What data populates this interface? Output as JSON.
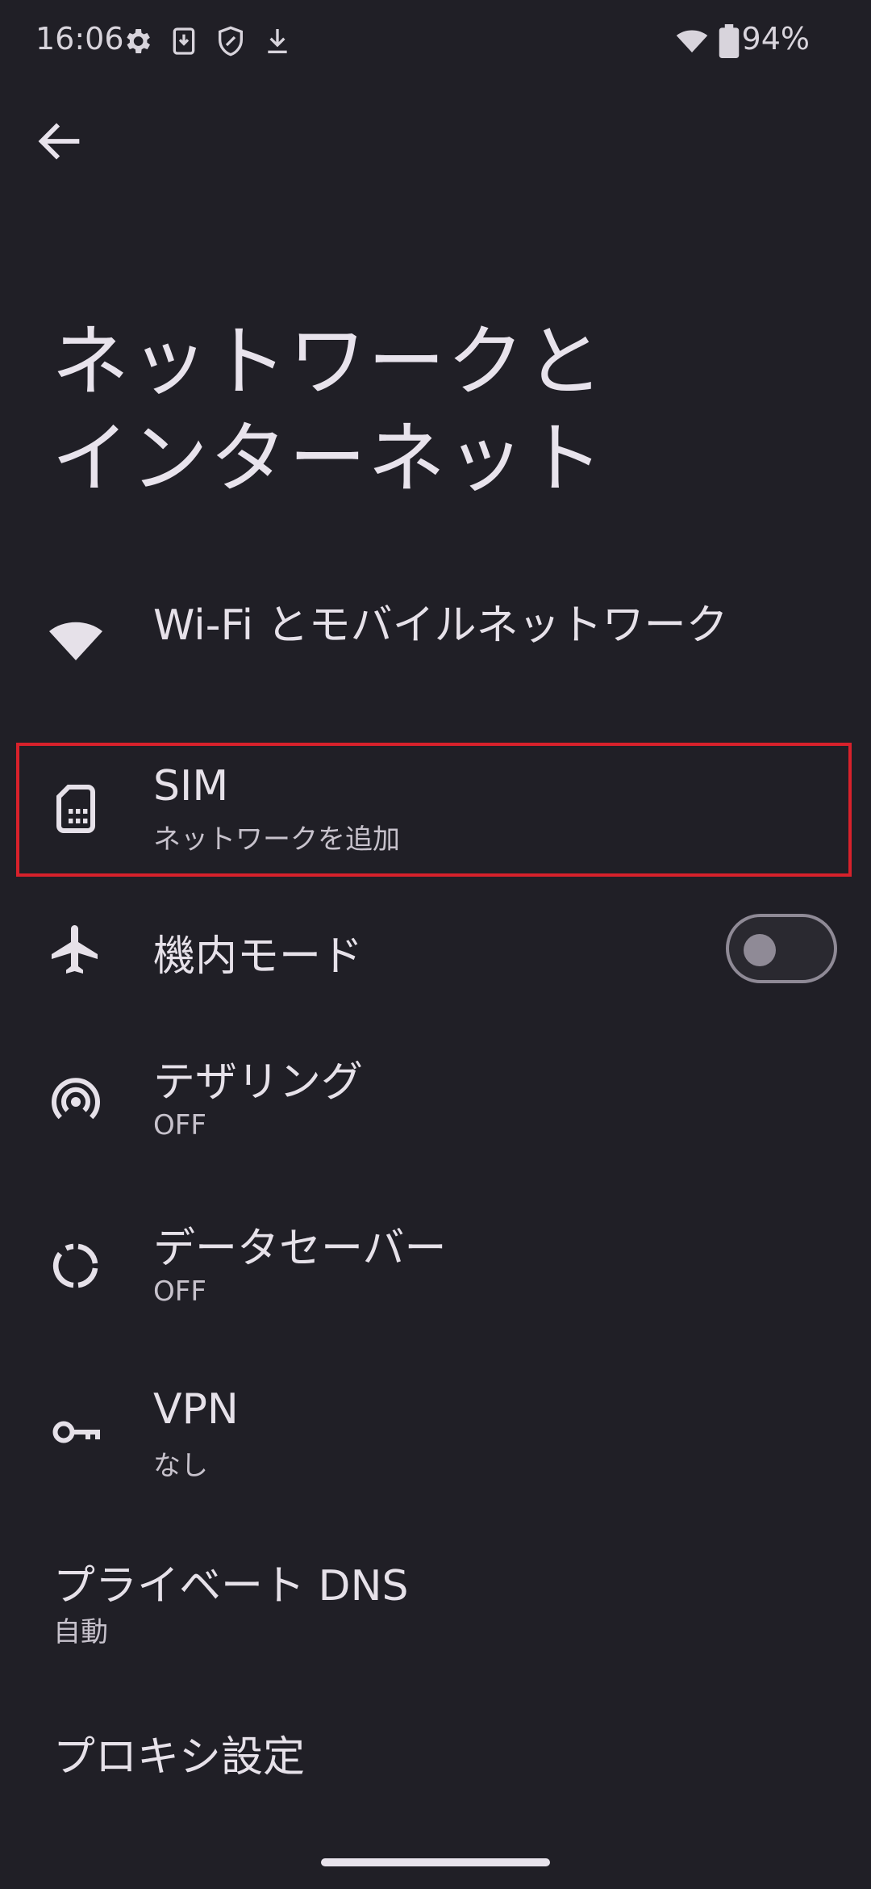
{
  "status_bar": {
    "time": "16:06",
    "icons": [
      "gear-icon",
      "download-box-icon",
      "shield-icon",
      "download-icon"
    ],
    "right_icons": [
      "wifi-icon",
      "battery-icon"
    ],
    "battery": "94%"
  },
  "header": {
    "back_icon": "back-arrow-icon",
    "title_line1": "ネットワークと",
    "title_line2": "インターネット"
  },
  "items": [
    {
      "icon": "wifi-icon",
      "title": "Wi-Fi とモバイルネットワーク"
    },
    {
      "icon": "sim-icon",
      "title": "SIM",
      "subtitle": "ネットワークを追加"
    },
    {
      "icon": "airplane-icon",
      "title": "機内モード",
      "toggle_on": false
    },
    {
      "icon": "hotspot-icon",
      "title": "テザリング",
      "subtitle": "OFF"
    },
    {
      "icon": "data-saver-icon",
      "title": "データセーバー",
      "subtitle": "OFF"
    },
    {
      "icon": "vpn-key-icon",
      "title": "VPN",
      "subtitle": "なし"
    },
    {
      "title": "プライベート DNS",
      "subtitle": "自動"
    },
    {
      "title": "プロキシ設定"
    }
  ],
  "colors": {
    "background": "#201f26",
    "text": "#e6e1e9",
    "highlight": "#d7212b"
  }
}
